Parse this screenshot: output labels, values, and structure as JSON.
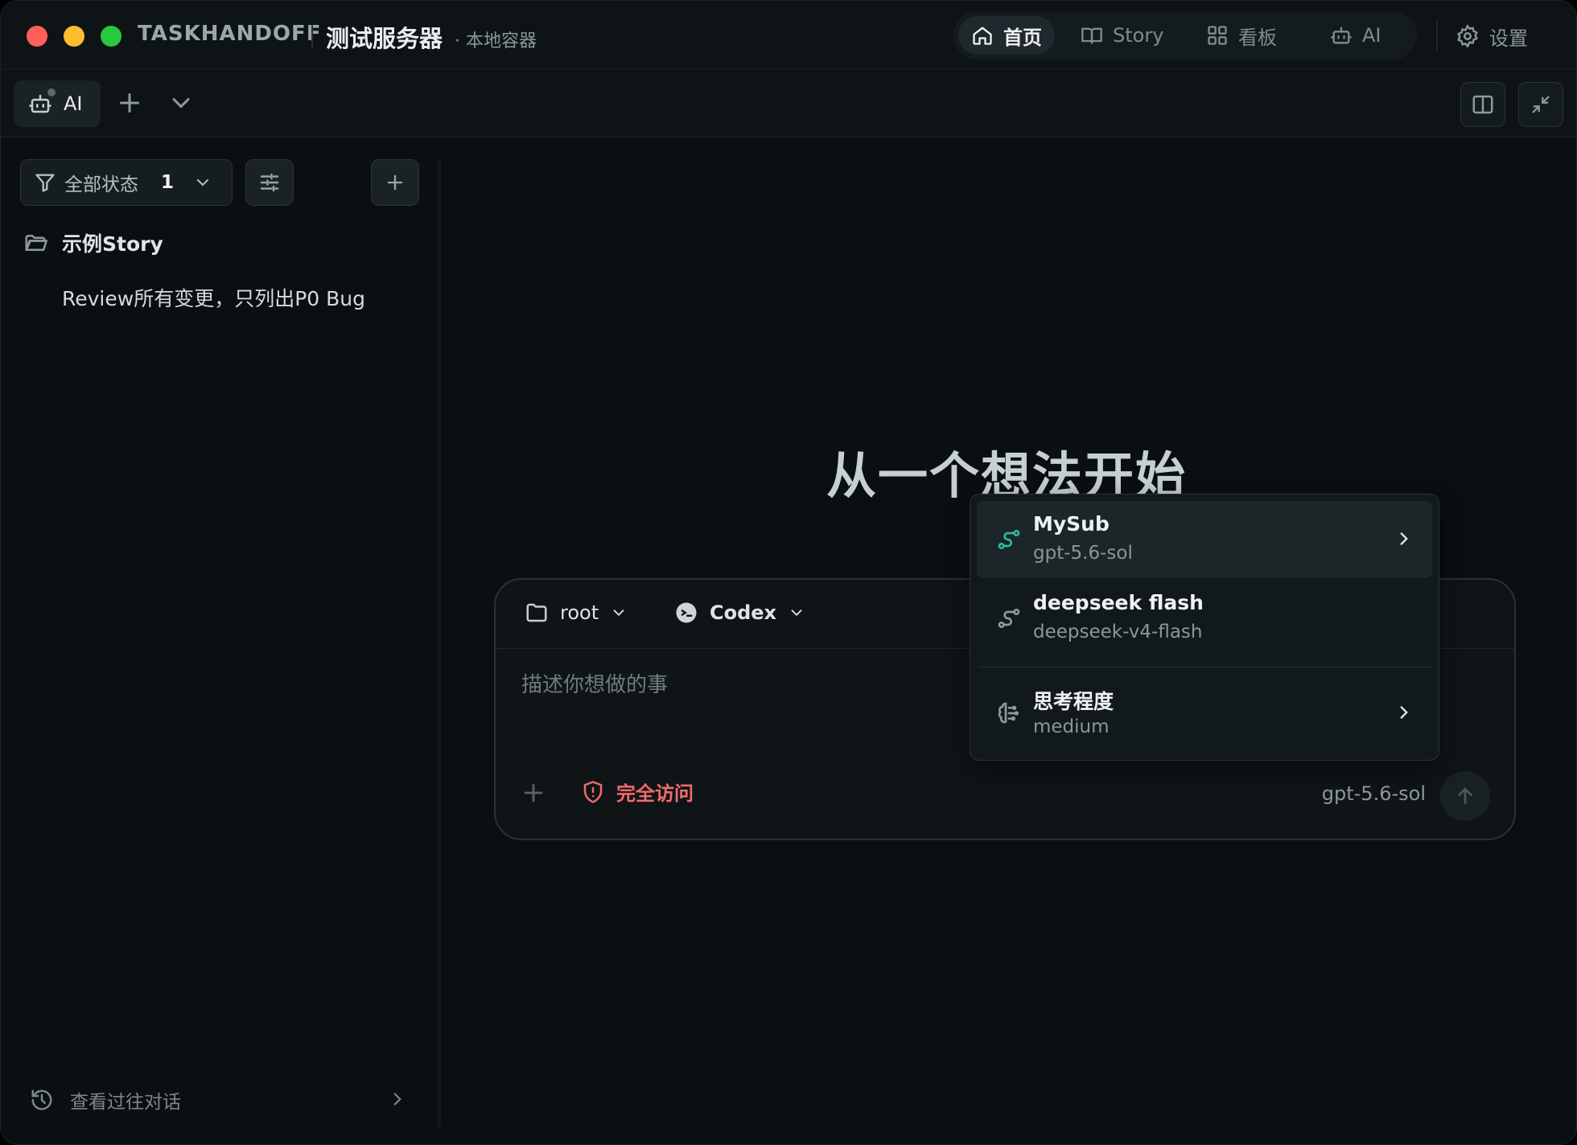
{
  "window": {
    "brand": "TASKHANDOFF",
    "server_name": "测试服务器",
    "server_sub": "· 本地容器"
  },
  "nav": {
    "items": [
      {
        "label": "首页",
        "icon": "home-icon",
        "active": true
      },
      {
        "label": "Story",
        "icon": "book-icon",
        "active": false
      },
      {
        "label": "看板",
        "icon": "grid-icon",
        "active": false
      },
      {
        "label": "AI",
        "icon": "robot-icon",
        "active": false
      }
    ],
    "settings_label": "设置"
  },
  "toolbar": {
    "tab_label": "AI"
  },
  "sidebar": {
    "filter_label": "全部状态",
    "filter_count": "1",
    "story_title": "示例Story",
    "story_item": "Review所有变更，只列出P0 Bug",
    "history_label": "查看过往对话"
  },
  "main": {
    "headline": "从一个想法开始",
    "composer": {
      "folder": "root",
      "agent": "Codex",
      "placeholder": "描述你想做的事",
      "access_label": "完全访问",
      "model_label": "gpt-5.6-sol"
    }
  },
  "dropdown": {
    "items": [
      {
        "title": "MySub",
        "sub": "gpt-5.6-sol",
        "icon": "route-icon"
      },
      {
        "title": "deepseek flash",
        "sub": "deepseek-v4-flash",
        "icon": "route-icon"
      },
      {
        "title": "思考程度",
        "sub": "medium",
        "icon": "brain-icon"
      }
    ]
  },
  "colors": {
    "accent_teal": "#2fb8a0",
    "danger": "#f26b6b"
  }
}
